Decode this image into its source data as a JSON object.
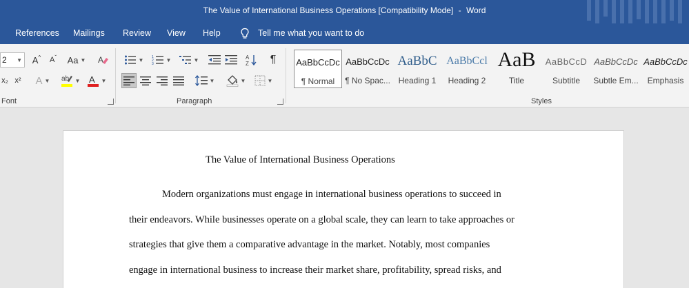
{
  "window": {
    "doc_name": "The Value of International Business Operations [Compatibility Mode]",
    "separator": "-",
    "app_name": "Word"
  },
  "menu": {
    "tabs": [
      "References",
      "Mailings",
      "Review",
      "View",
      "Help"
    ],
    "tell_me": "Tell me what you want to do"
  },
  "ribbon": {
    "font_size_value": "2",
    "grow_font": "A",
    "shrink_font": "A",
    "change_case": "Aa",
    "subscript": "x₂",
    "superscript": "x²",
    "text_effects": "A",
    "font_color_letter": "A",
    "font_group_label": "Font",
    "paragraph_group_label": "Paragraph",
    "styles_group_label": "Styles",
    "pilcrow": "¶",
    "styles": [
      {
        "sample": "AaBbCcDc",
        "name": "¶ Normal"
      },
      {
        "sample": "AaBbCcDc",
        "name": "¶ No Spac..."
      },
      {
        "sample": "AaBbC",
        "name": "Heading 1"
      },
      {
        "sample": "AaBbCcl",
        "name": "Heading 2"
      },
      {
        "sample": "AaB",
        "name": "Title"
      },
      {
        "sample": "AaBbCcD",
        "name": "Subtitle"
      },
      {
        "sample": "AaBbCcDc",
        "name": "Subtle Em..."
      },
      {
        "sample": "AaBbCcDc",
        "name": "Emphasis"
      }
    ],
    "colors": {
      "highlight": "#ffff00",
      "font_color": "#e02020"
    }
  },
  "document": {
    "title": "The Value of International Business Operations",
    "lines": [
      "Modern organizations must engage in international business operations to succeed in",
      "their endeavors.  While businesses operate on a global scale, they can learn to take approaches or",
      "strategies that give them a comparative advantage in the market. Notably, most companies",
      "engage in international business to increase their market share, profitability, spread risks, and"
    ]
  }
}
